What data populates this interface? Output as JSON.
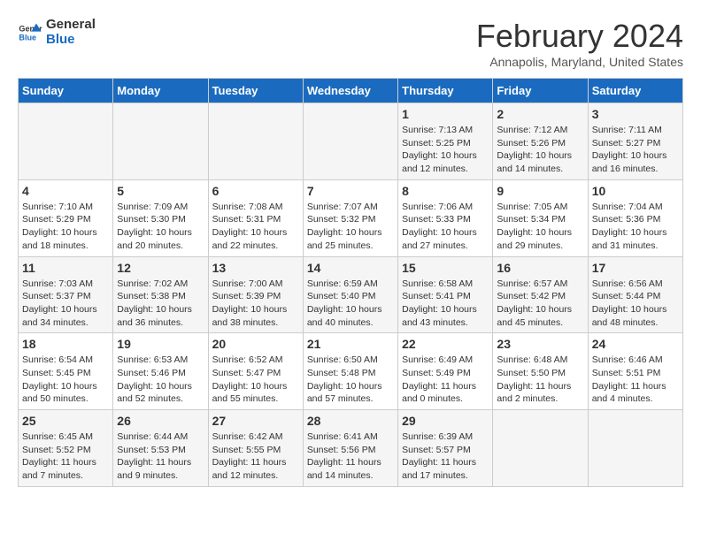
{
  "logo": {
    "line1": "General",
    "line2": "Blue"
  },
  "title": "February 2024",
  "location": "Annapolis, Maryland, United States",
  "days_of_week": [
    "Sunday",
    "Monday",
    "Tuesday",
    "Wednesday",
    "Thursday",
    "Friday",
    "Saturday"
  ],
  "weeks": [
    [
      {
        "day": "",
        "info": ""
      },
      {
        "day": "",
        "info": ""
      },
      {
        "day": "",
        "info": ""
      },
      {
        "day": "",
        "info": ""
      },
      {
        "day": "1",
        "info": "Sunrise: 7:13 AM\nSunset: 5:25 PM\nDaylight: 10 hours\nand 12 minutes."
      },
      {
        "day": "2",
        "info": "Sunrise: 7:12 AM\nSunset: 5:26 PM\nDaylight: 10 hours\nand 14 minutes."
      },
      {
        "day": "3",
        "info": "Sunrise: 7:11 AM\nSunset: 5:27 PM\nDaylight: 10 hours\nand 16 minutes."
      }
    ],
    [
      {
        "day": "4",
        "info": "Sunrise: 7:10 AM\nSunset: 5:29 PM\nDaylight: 10 hours\nand 18 minutes."
      },
      {
        "day": "5",
        "info": "Sunrise: 7:09 AM\nSunset: 5:30 PM\nDaylight: 10 hours\nand 20 minutes."
      },
      {
        "day": "6",
        "info": "Sunrise: 7:08 AM\nSunset: 5:31 PM\nDaylight: 10 hours\nand 22 minutes."
      },
      {
        "day": "7",
        "info": "Sunrise: 7:07 AM\nSunset: 5:32 PM\nDaylight: 10 hours\nand 25 minutes."
      },
      {
        "day": "8",
        "info": "Sunrise: 7:06 AM\nSunset: 5:33 PM\nDaylight: 10 hours\nand 27 minutes."
      },
      {
        "day": "9",
        "info": "Sunrise: 7:05 AM\nSunset: 5:34 PM\nDaylight: 10 hours\nand 29 minutes."
      },
      {
        "day": "10",
        "info": "Sunrise: 7:04 AM\nSunset: 5:36 PM\nDaylight: 10 hours\nand 31 minutes."
      }
    ],
    [
      {
        "day": "11",
        "info": "Sunrise: 7:03 AM\nSunset: 5:37 PM\nDaylight: 10 hours\nand 34 minutes."
      },
      {
        "day": "12",
        "info": "Sunrise: 7:02 AM\nSunset: 5:38 PM\nDaylight: 10 hours\nand 36 minutes."
      },
      {
        "day": "13",
        "info": "Sunrise: 7:00 AM\nSunset: 5:39 PM\nDaylight: 10 hours\nand 38 minutes."
      },
      {
        "day": "14",
        "info": "Sunrise: 6:59 AM\nSunset: 5:40 PM\nDaylight: 10 hours\nand 40 minutes."
      },
      {
        "day": "15",
        "info": "Sunrise: 6:58 AM\nSunset: 5:41 PM\nDaylight: 10 hours\nand 43 minutes."
      },
      {
        "day": "16",
        "info": "Sunrise: 6:57 AM\nSunset: 5:42 PM\nDaylight: 10 hours\nand 45 minutes."
      },
      {
        "day": "17",
        "info": "Sunrise: 6:56 AM\nSunset: 5:44 PM\nDaylight: 10 hours\nand 48 minutes."
      }
    ],
    [
      {
        "day": "18",
        "info": "Sunrise: 6:54 AM\nSunset: 5:45 PM\nDaylight: 10 hours\nand 50 minutes."
      },
      {
        "day": "19",
        "info": "Sunrise: 6:53 AM\nSunset: 5:46 PM\nDaylight: 10 hours\nand 52 minutes."
      },
      {
        "day": "20",
        "info": "Sunrise: 6:52 AM\nSunset: 5:47 PM\nDaylight: 10 hours\nand 55 minutes."
      },
      {
        "day": "21",
        "info": "Sunrise: 6:50 AM\nSunset: 5:48 PM\nDaylight: 10 hours\nand 57 minutes."
      },
      {
        "day": "22",
        "info": "Sunrise: 6:49 AM\nSunset: 5:49 PM\nDaylight: 11 hours\nand 0 minutes."
      },
      {
        "day": "23",
        "info": "Sunrise: 6:48 AM\nSunset: 5:50 PM\nDaylight: 11 hours\nand 2 minutes."
      },
      {
        "day": "24",
        "info": "Sunrise: 6:46 AM\nSunset: 5:51 PM\nDaylight: 11 hours\nand 4 minutes."
      }
    ],
    [
      {
        "day": "25",
        "info": "Sunrise: 6:45 AM\nSunset: 5:52 PM\nDaylight: 11 hours\nand 7 minutes."
      },
      {
        "day": "26",
        "info": "Sunrise: 6:44 AM\nSunset: 5:53 PM\nDaylight: 11 hours\nand 9 minutes."
      },
      {
        "day": "27",
        "info": "Sunrise: 6:42 AM\nSunset: 5:55 PM\nDaylight: 11 hours\nand 12 minutes."
      },
      {
        "day": "28",
        "info": "Sunrise: 6:41 AM\nSunset: 5:56 PM\nDaylight: 11 hours\nand 14 minutes."
      },
      {
        "day": "29",
        "info": "Sunrise: 6:39 AM\nSunset: 5:57 PM\nDaylight: 11 hours\nand 17 minutes."
      },
      {
        "day": "",
        "info": ""
      },
      {
        "day": "",
        "info": ""
      }
    ]
  ]
}
